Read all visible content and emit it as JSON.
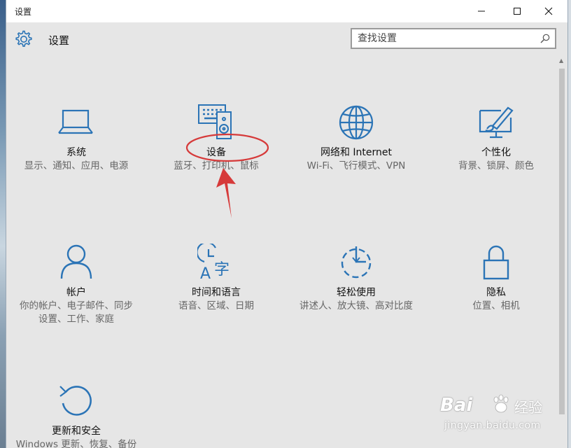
{
  "window": {
    "title": "设置"
  },
  "header": {
    "title": "设置",
    "search_placeholder": "查找设置"
  },
  "tiles": [
    {
      "title": "系统",
      "desc": "显示、通知、应用、电源",
      "icon": "monitor-icon"
    },
    {
      "title": "设备",
      "desc": "蓝牙、打印机、鼠标",
      "icon": "devices-icon"
    },
    {
      "title": "网络和 Internet",
      "desc": "Wi-Fi、飞行模式、VPN",
      "icon": "globe-icon"
    },
    {
      "title": "个性化",
      "desc": "背景、锁屏、颜色",
      "icon": "paintbrush-icon"
    },
    {
      "title": "帐户",
      "desc": "你的帐户、电子邮件、同步设置、工作、家庭",
      "icon": "person-icon"
    },
    {
      "title": "时间和语言",
      "desc": "语音、区域、日期",
      "icon": "clock-language-icon"
    },
    {
      "title": "轻松使用",
      "desc": "讲述人、放大镜、高对比度",
      "icon": "ease-of-access-icon"
    },
    {
      "title": "隐私",
      "desc": "位置、相机",
      "icon": "lock-icon"
    },
    {
      "title": "更新和安全",
      "desc": "Windows 更新、恢复、备份",
      "icon": "refresh-icon"
    }
  ],
  "watermark": {
    "brand": "Bai",
    "brand_cn": "经验",
    "url": "jingyan.baidu.com"
  },
  "colors": {
    "accent": "#2b74b6",
    "annotation": "#d63a3a",
    "window_bg": "#e6e6e6"
  }
}
